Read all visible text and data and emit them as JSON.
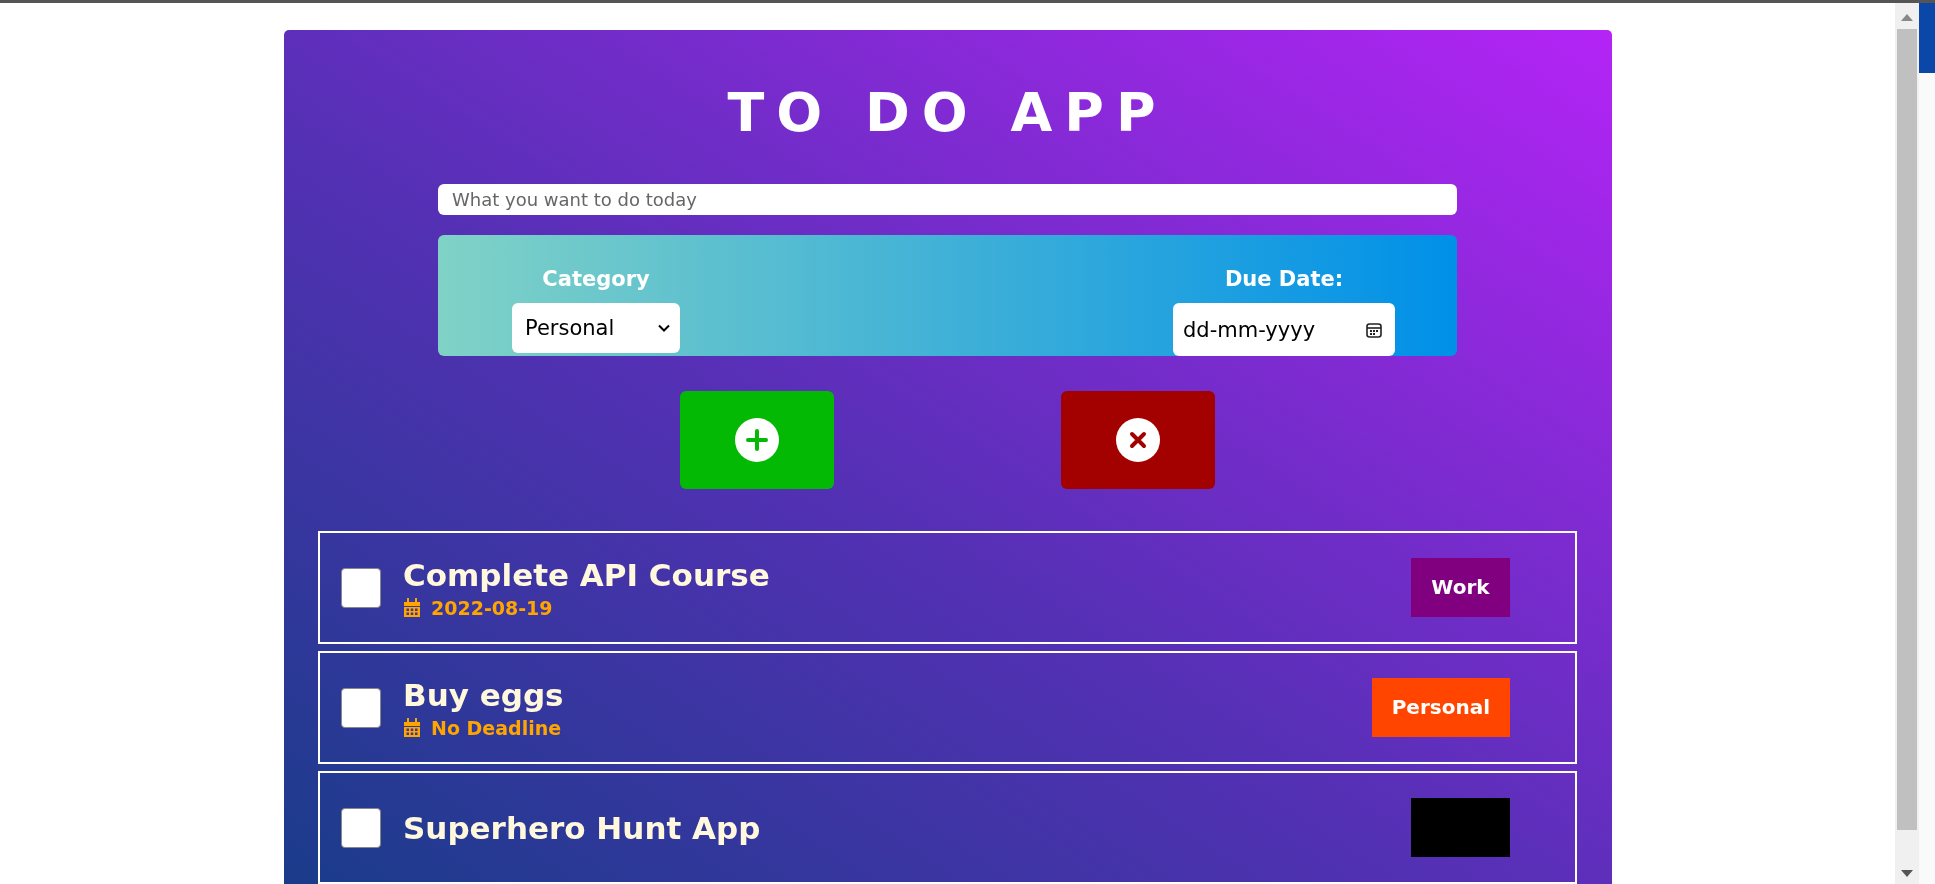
{
  "title": "TO DO APP",
  "task_input": {
    "placeholder": "What you want to do today"
  },
  "options": {
    "category_label": "Category",
    "category_value": "Personal",
    "due_label": "Due Date:",
    "due_value": "dd-mm-yyyy"
  },
  "buttons": [
    {
      "kind": "add"
    },
    {
      "kind": "clear"
    }
  ],
  "todos": [
    {
      "title": "Complete API Course",
      "date": "2022-08-19",
      "checked": false,
      "tag": "Work",
      "color": "#800080"
    },
    {
      "title": "Buy eggs",
      "date": "No Deadline",
      "checked": false,
      "tag": "Personal",
      "color": "#ff4500"
    },
    {
      "title": "Superhero Hunt App",
      "checked": false,
      "color": "#000000"
    }
  ]
}
